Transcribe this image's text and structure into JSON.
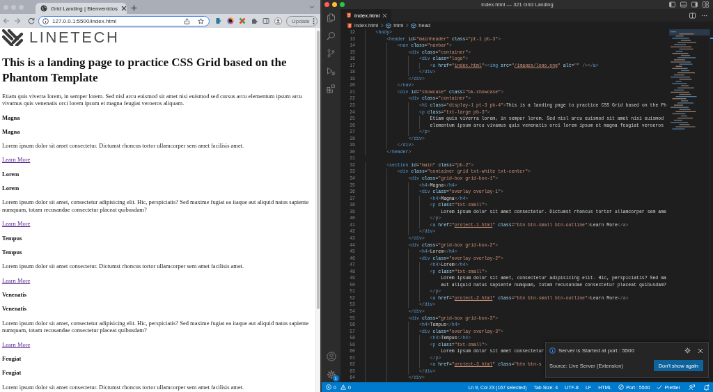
{
  "browser": {
    "tab_title": "Grid Landing | Bienvenidos",
    "url": "127.0.0.1:5500/index.html",
    "update_button": "Update"
  },
  "page": {
    "logo_text": "LINETECH",
    "heading": "This is a landing page to practice CSS Grid based on the Phantom Template",
    "intro": "Etiam quis viverra lorem, in semper lorem. Sed nisl arcu euismod sit amet nisi euismod sed cursus arcu elementum ipsum arcu vivamus quis venenatis orci lorem ipsum et magna feugiat veroeros aliquam.",
    "sections": [
      {
        "title": "Magna",
        "overlay_title": "Magna",
        "text": "Lorem ipsum dolor sit amet consectetur. Dictumst rhoncus tortor ullamcorper sem amet facilisis amet.",
        "link": "Learn More",
        "visited": true
      },
      {
        "title": "Lorem",
        "overlay_title": "Lorem",
        "text": "Lorem ipsum dolor sit amet, consectetur adipisicing elit. Hic, perspiciatis? Sed maxime fugiat ea itaque aut aliquid natus sapiente numquam, totam recusandae consectetur placeat quibusdam?",
        "link": "Learn More",
        "visited": true
      },
      {
        "title": "Tempus",
        "overlay_title": "Tempus",
        "text": "Lorem ipsum dolor sit amet consectetur. Dictumst rhoncus tortor ullamcorper sem amet facilisis amet.",
        "link": "Learn More",
        "visited": true
      },
      {
        "title": "Venenatis",
        "overlay_title": "Venenatis",
        "text": "Lorem ipsum dolor sit amet, consectetur adipisicing elit. Hic, perspiciatis? Sed maxime fugiat ea itaque aut aliquid natus sapiente numquam, totam recusandae consectetur placeat quibusdam?",
        "link": "Learn More",
        "visited": true
      },
      {
        "title": "Feugiat",
        "overlay_title": "Feugiat",
        "text": "Lorem ipsum dolor sit amet consectetur. Dictumst rhoncus tortor ullamcorper sem amet facilisis amet."
      }
    ]
  },
  "editor": {
    "window_title": "index.html — 321 Grid Landing",
    "tabs": [
      {
        "label": "index.html",
        "selected": true
      }
    ],
    "breadcrumbs": [
      {
        "label": "index.html",
        "kind": "file"
      },
      {
        "label": "html",
        "kind": "element"
      },
      {
        "label": "head",
        "kind": "element"
      }
    ],
    "lines": [
      {
        "number": "12",
        "text": "    <body>"
      },
      {
        "number": "13",
        "text": "        <header id=\"mainheader\" class=\"pt-1 pb-3\">"
      },
      {
        "number": "14",
        "text": "            <nav class=\"navbar\">"
      },
      {
        "number": "15",
        "text": "                <div class=\"container\">"
      },
      {
        "number": "16",
        "text": "                    <div class=\"logo\">"
      },
      {
        "number": "17",
        "text": "                        <a href=\"index.html\"><img src=\"/images/logo.png\" alt=\"\" /></a>"
      },
      {
        "number": "18",
        "text": "                    </div>"
      },
      {
        "number": "19",
        "text": "                </div>"
      },
      {
        "number": "20",
        "text": "            </nav>"
      },
      {
        "number": "21",
        "text": "            <div id=\"showcase\" class=\"bk-showcase\">"
      },
      {
        "number": "22",
        "text": "                <div class=\"container\">"
      },
      {
        "number": "23",
        "text": "                    <h1 class=\"display-1 pt-3 pb-4\">This is a landing page to practice CSS Grid based on the Ph"
      },
      {
        "number": "24",
        "text": "                    <p class=\"txt-large pb-3\">"
      },
      {
        "number": "25",
        "text": "                        Etiam quis viverra lorem, in semper lorem. Sed nisl arcu euismod sit amet nisi euismod"
      },
      {
        "number": "26",
        "text": "                        elementum ipsum arcu vivamus quis venenatis orci lorem ipsum et magna feugiat veroeros"
      },
      {
        "number": "27",
        "text": "                    </p>"
      },
      {
        "number": "28",
        "text": "                </div>"
      },
      {
        "number": "29",
        "text": "            </div>"
      },
      {
        "number": "30",
        "text": "        </header>"
      },
      {
        "number": "31"
      },
      {
        "number": "32",
        "text": "        <section id=\"main\" class=\"pb-2\">"
      },
      {
        "number": "33",
        "text": "            <div class=\"container grid txt-white txt-center\">"
      },
      {
        "number": "34",
        "text": "                <div class=\"grid-box grid-box-1\">"
      },
      {
        "number": "35",
        "text": "                    <h4>Magna</h4>"
      },
      {
        "number": "36",
        "text": "                    <div class=\"overlay overlay-1\">"
      },
      {
        "number": "37",
        "text": "                        <h4>Magna</h4>"
      },
      {
        "number": "38",
        "text": "                        <p class=\"txt-small\">"
      },
      {
        "number": "39",
        "text": "                            Lorem ipsum dolor sit amet consectetur. Dictumst rhoncus tortor ullamcorper sem ame"
      },
      {
        "number": "40",
        "text": "                        </p>"
      },
      {
        "number": "41",
        "text": "                        <a href=\"project-1.html\" class=\"btn btn-small btn-outline\">Learn More</a>"
      },
      {
        "number": "42",
        "text": "                    </div>"
      },
      {
        "number": "43",
        "text": "                </div>"
      },
      {
        "number": "44",
        "text": "                <div class=\"grid-box grid-box-2\">"
      },
      {
        "number": "45",
        "text": "                    <h4>Lorem</h4>"
      },
      {
        "number": "46",
        "text": "                    <div class=\"overlay overlay-2\">"
      },
      {
        "number": "47",
        "text": "                        <h4>Lorem</h4>"
      },
      {
        "number": "48",
        "text": "                        <p class=\"txt-small\">"
      },
      {
        "number": "49",
        "text": "                            Lorem ipsum dolor sit amet, consectetur adipisicing elit. Hic, perspiciatis? Sed ma"
      },
      {
        "number": "50",
        "text": "                            aut aliquid natus sapiente numquam, totam recusandae consectetur placeat quibusdam?"
      },
      {
        "number": "51",
        "text": "                        </p>"
      },
      {
        "number": "52",
        "text": "                        <a href=\"project-2.html\" class=\"btn btn-small btn-outline\">Learn More</a>"
      },
      {
        "number": "53",
        "text": "                    </div>"
      },
      {
        "number": "54",
        "text": "                </div>"
      },
      {
        "number": "55",
        "text": "                <div class=\"grid-box grid-box-3\">"
      },
      {
        "number": "56",
        "text": "                    <h4>Tempus</h4>"
      },
      {
        "number": "57",
        "text": "                    <div class=\"overlay overlay-3\">"
      },
      {
        "number": "58",
        "text": "                        <h4>Tempus</h4>"
      },
      {
        "number": "59",
        "text": "                        <p class=\"txt-small\">"
      },
      {
        "number": "60",
        "text": "                            Lorem ipsum dolor sit amet consectetur"
      },
      {
        "number": "61",
        "text": "                        </p>"
      },
      {
        "number": "62",
        "text": "                        <a href=\"project-3.html\" class=\"btn btn-s"
      },
      {
        "number": "63",
        "text": "                    </div>"
      },
      {
        "number": "64",
        "text": "                </div>"
      }
    ]
  },
  "activity_badge": "1",
  "notification": {
    "message": "Server is Started at port : 5500",
    "source": "Source: Live Server (Extension)",
    "button": "Don't show again"
  },
  "status_bar": {
    "errors": "0",
    "warnings": "0",
    "items": [
      {
        "label": "Ln 9, Col 23 (167 selected)",
        "kind": "text"
      },
      {
        "label": "Tab Size: 4",
        "kind": "text"
      },
      {
        "label": "UTF-8",
        "kind": "text"
      },
      {
        "label": "LF",
        "kind": "text"
      },
      {
        "label": "HTML",
        "kind": "text"
      },
      {
        "label": "Port : 5500",
        "kind": "port"
      },
      {
        "label": "Prettier",
        "kind": "check"
      }
    ]
  }
}
